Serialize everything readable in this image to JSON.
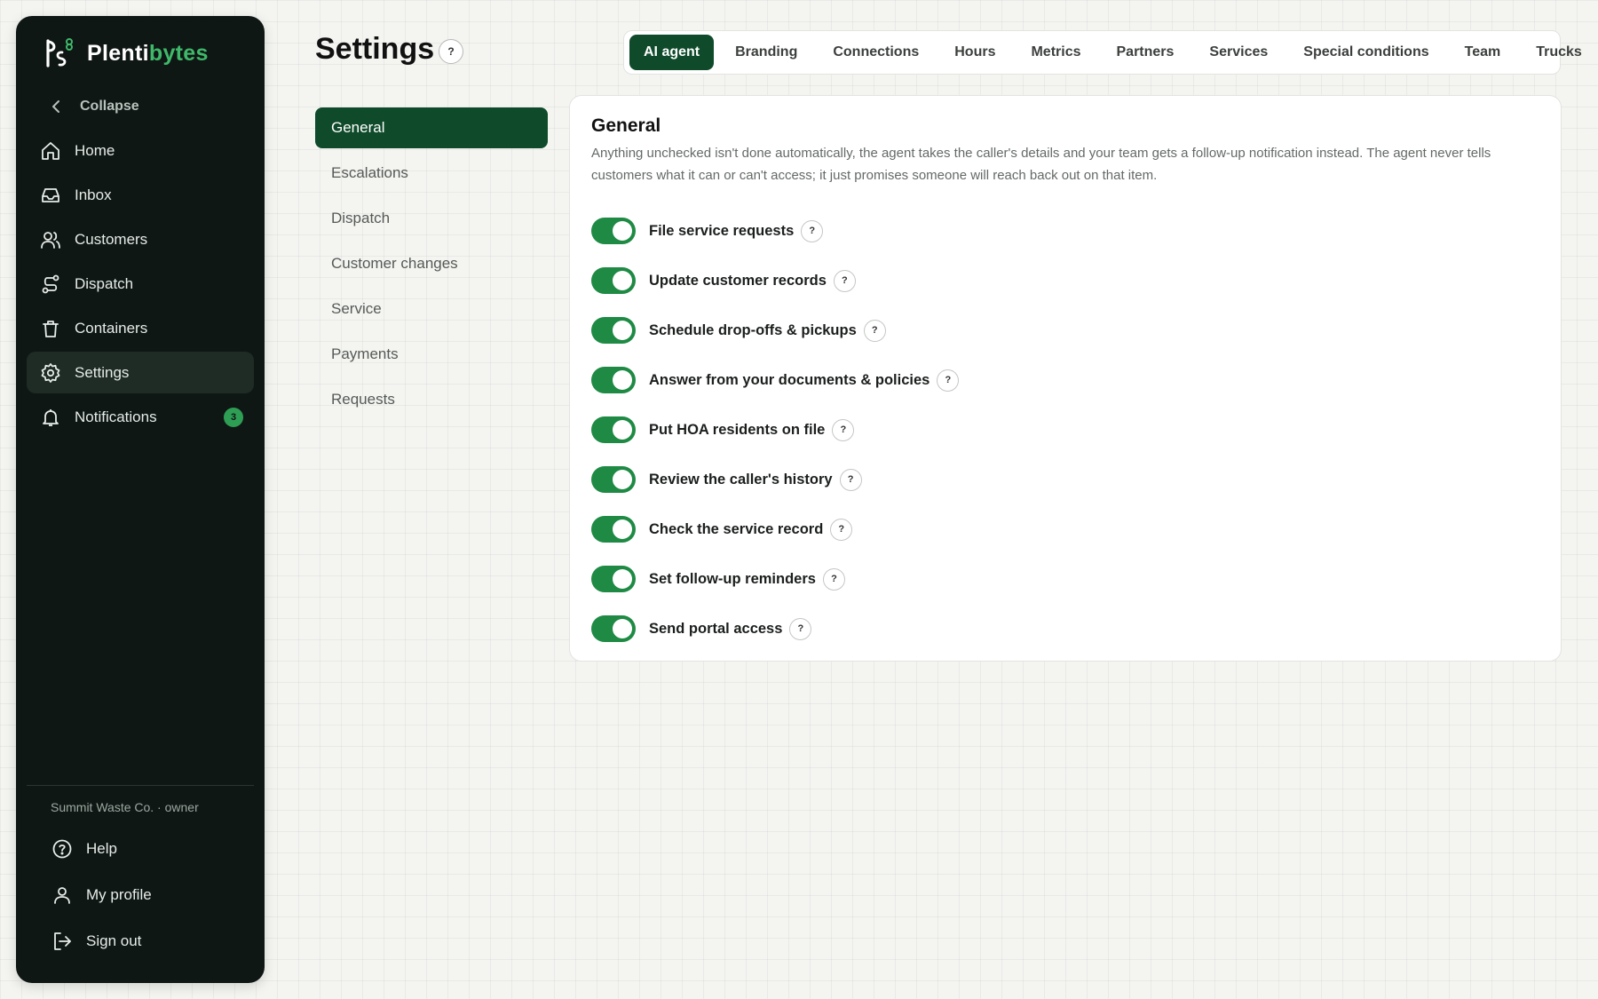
{
  "brand": {
    "name_main": "Plenti",
    "name_accent": "bytes"
  },
  "sidebar": {
    "collapse_label": "Collapse",
    "items": [
      {
        "label": "Home",
        "icon": "home-icon"
      },
      {
        "label": "Inbox",
        "icon": "inbox-icon"
      },
      {
        "label": "Customers",
        "icon": "users-icon"
      },
      {
        "label": "Dispatch",
        "icon": "route-icon"
      },
      {
        "label": "Containers",
        "icon": "bin-icon"
      },
      {
        "label": "Settings",
        "icon": "gear-icon",
        "active": true
      },
      {
        "label": "Notifications",
        "icon": "bell-icon",
        "badge": "3"
      }
    ],
    "org": "Summit Waste Co. · owner",
    "footer": [
      {
        "label": "Help",
        "icon": "help-icon"
      },
      {
        "label": "My profile",
        "icon": "user-icon"
      },
      {
        "label": "Sign out",
        "icon": "sign-out-icon"
      }
    ]
  },
  "header": {
    "title": "Settings",
    "help": "?"
  },
  "tabs": [
    "AI agent",
    "Branding",
    "Connections",
    "Hours",
    "Metrics",
    "Partners",
    "Services",
    "Special conditions",
    "Team",
    "Trucks"
  ],
  "subnav": [
    "General",
    "Escalations",
    "Dispatch",
    "Customer changes",
    "Service",
    "Payments",
    "Requests"
  ],
  "main": {
    "title": "General",
    "description": "Anything unchecked isn't done automatically, the agent takes the caller's details and your team gets a follow-up notification instead. The agent never tells customers what it can or can't access; it just promises someone will reach back out on that item.",
    "toggles": [
      {
        "label": "File service requests",
        "on": true
      },
      {
        "label": "Update customer records",
        "on": true
      },
      {
        "label": "Schedule drop-offs & pickups",
        "on": true
      },
      {
        "label": "Answer from your documents & policies",
        "on": true
      },
      {
        "label": "Put HOA residents on file",
        "on": true
      },
      {
        "label": "Review the caller's history",
        "on": true
      },
      {
        "label": "Check the service record",
        "on": true
      },
      {
        "label": "Set follow-up reminders",
        "on": true
      },
      {
        "label": "Send portal access",
        "on": true
      }
    ]
  },
  "colors": {
    "sidebar_bg": "#0f1714",
    "accent": "#0f4a2a",
    "toggle_on": "#1e8a44",
    "brand_accent": "#3fb86a"
  }
}
